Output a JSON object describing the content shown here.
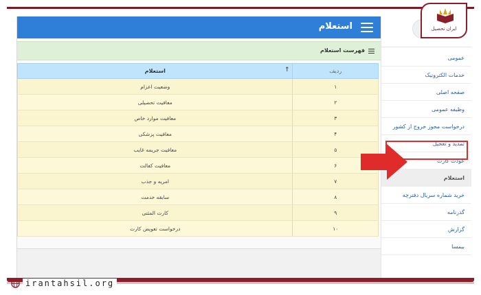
{
  "app": {
    "title": "استعلام"
  },
  "list_section": {
    "title": "فهرست استعلام"
  },
  "table": {
    "columns": {
      "name": "استعلام",
      "index": "ردیف"
    },
    "rows": [
      {
        "index": "۱",
        "name": "وضعیت اعزام"
      },
      {
        "index": "۲",
        "name": "معافیت تحصیلی"
      },
      {
        "index": "۳",
        "name": "معافیت موارد خاص"
      },
      {
        "index": "۴",
        "name": "معافیت پزشکی"
      },
      {
        "index": "۵",
        "name": "معافیت جریمه غایب"
      },
      {
        "index": "۶",
        "name": "معافیت کفالت"
      },
      {
        "index": "۷",
        "name": "امریه و جذب"
      },
      {
        "index": "۸",
        "name": "سابقه خدمت"
      },
      {
        "index": "۹",
        "name": "کارت المثنی"
      },
      {
        "index": "۱۰",
        "name": "درخواست تعویض کارت"
      }
    ]
  },
  "sidebar": {
    "items": [
      {
        "label": "عمومی"
      },
      {
        "label": "خدمات الکترونیک"
      },
      {
        "label": "صفحه اصلی"
      },
      {
        "label": "وظیفه عمومی"
      },
      {
        "label": "درخواست مجوز خروج از کشور"
      },
      {
        "label": "تمدید و تعجیل"
      },
      {
        "label": "عودت کارت"
      },
      {
        "label": "استعلام"
      },
      {
        "label": "خرید شماره سریال دفترچه"
      },
      {
        "label": "گذرنامه"
      },
      {
        "label": "گزارش"
      },
      {
        "label": "بیمسا"
      }
    ]
  },
  "logo": {
    "text": "ایران تحصیل"
  },
  "watermark": {
    "text": "irantahsil.org"
  },
  "colors": {
    "header_blue": "#2f7fd8",
    "list_green": "#dff0d8",
    "table_head": "#bfe4fb",
    "row_yellow": "#fdf8d8",
    "highlight_red": "#e02b2b",
    "brand_maroon": "#8b1e2b"
  },
  "icons": {
    "menu": "hamburger-icon",
    "list": "list-icon",
    "sort": "sort-arrow-icon",
    "arrow": "red-arrow-icon",
    "globe": "globe-icon"
  }
}
